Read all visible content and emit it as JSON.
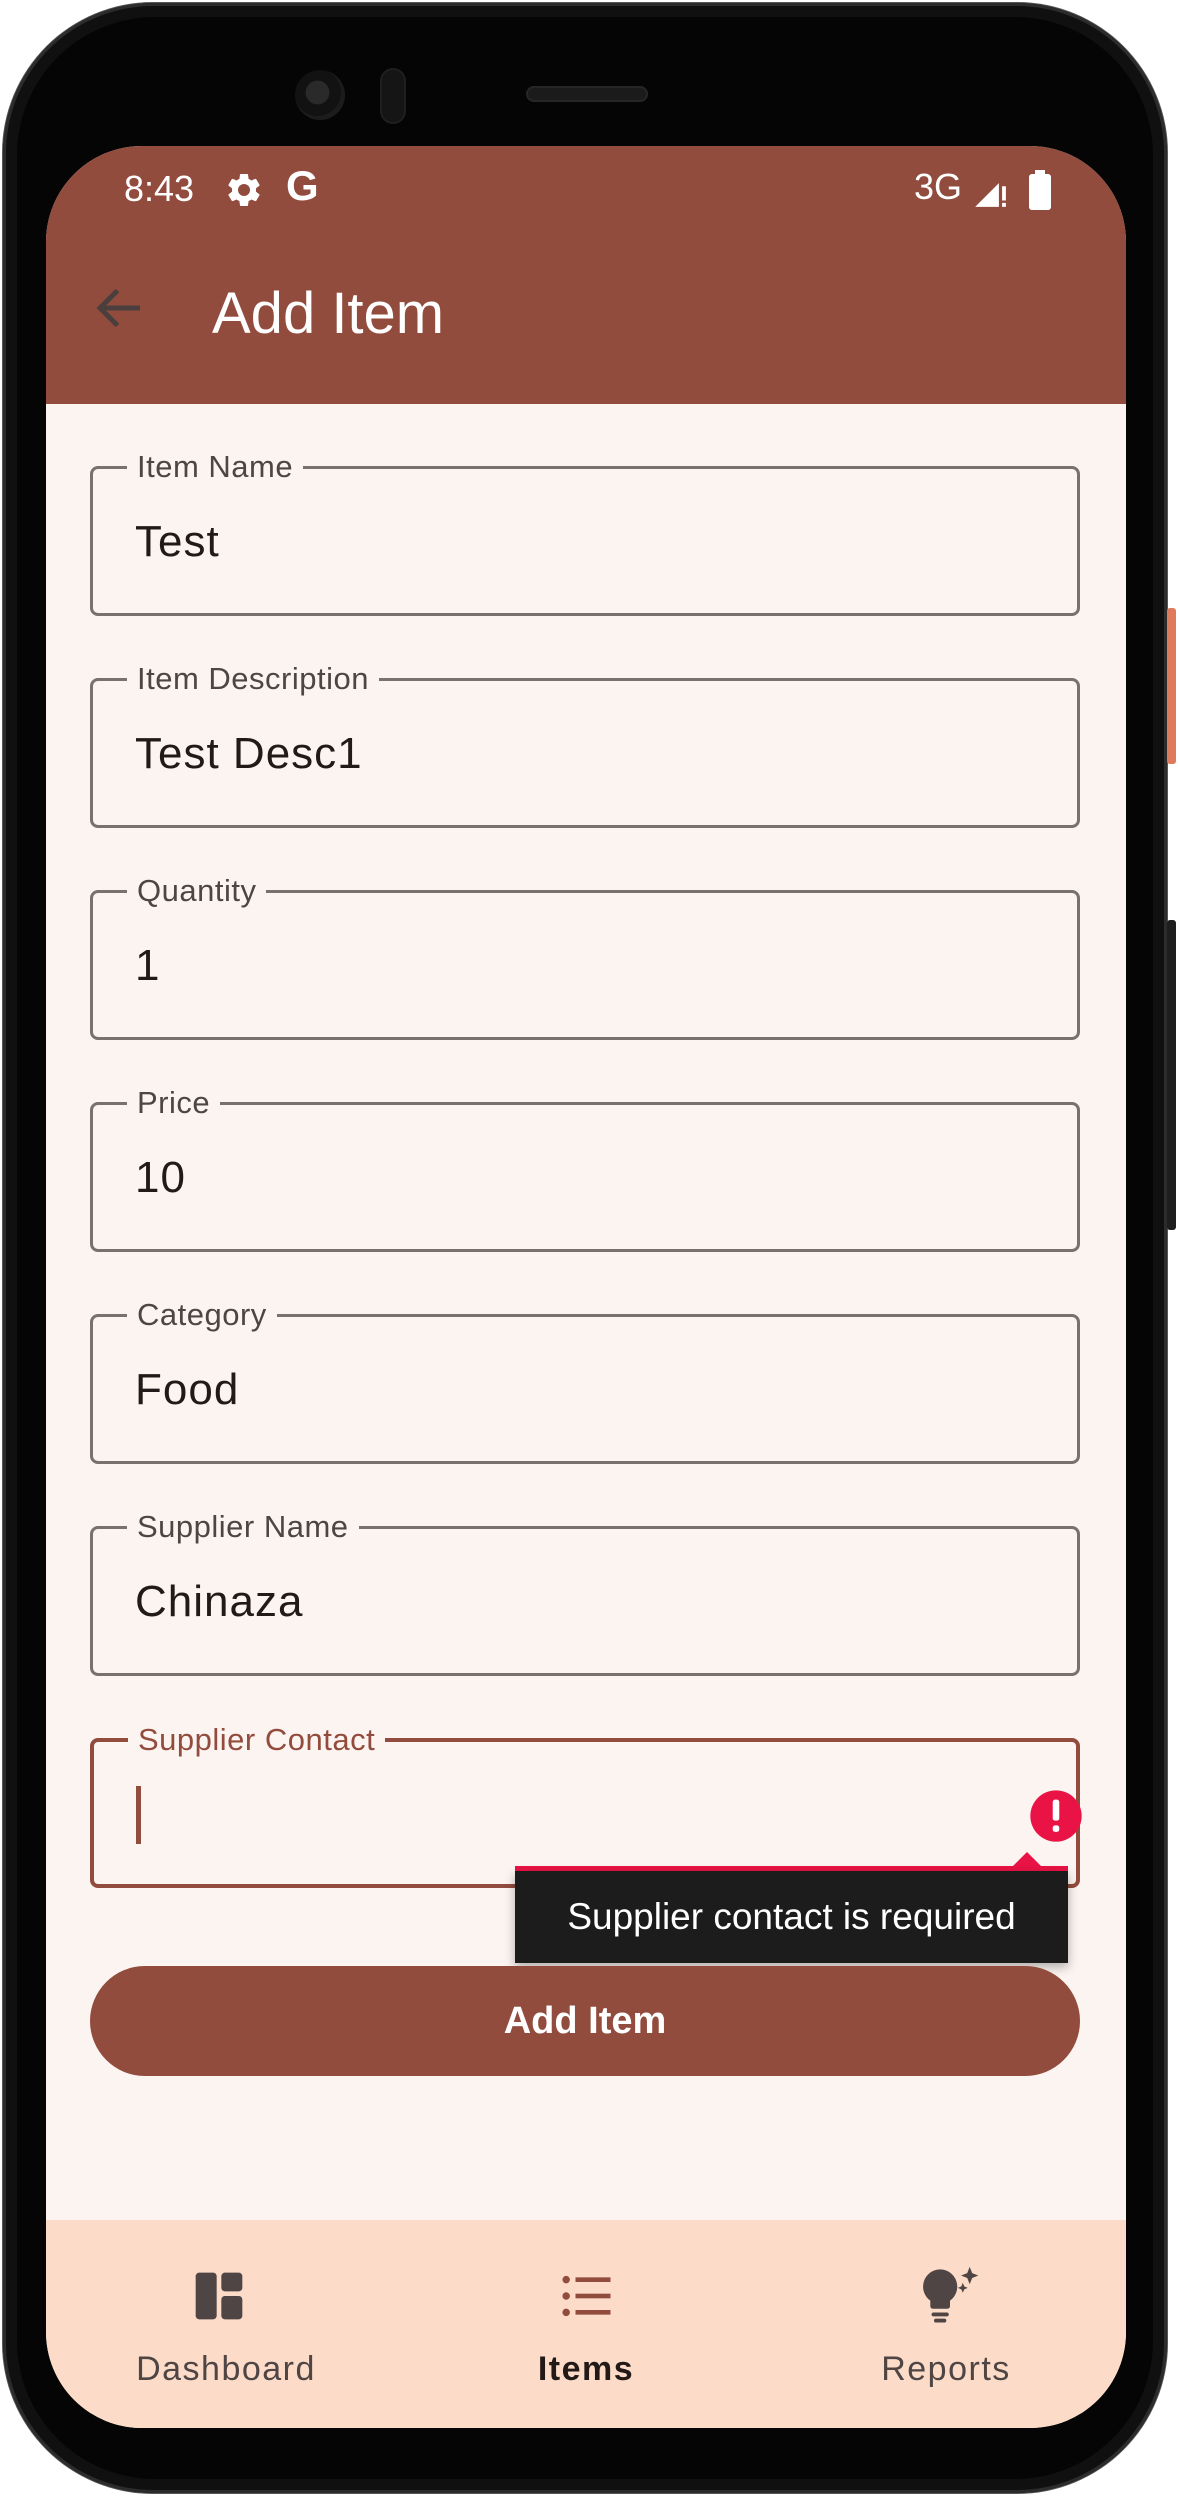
{
  "status_bar": {
    "time": "8:43",
    "g_glyph": "G",
    "network": "3G",
    "icons": [
      "gear-icon",
      "google-icon",
      "signal-icon",
      "battery-icon"
    ]
  },
  "app_bar": {
    "title": "Add Item",
    "back_icon": "arrow-back-icon"
  },
  "form": {
    "fields": [
      {
        "label": "Item Name",
        "value": "Test"
      },
      {
        "label": "Item Description",
        "value": "Test Desc1"
      },
      {
        "label": "Quantity",
        "value": "1"
      },
      {
        "label": "Price",
        "value": "10"
      },
      {
        "label": "Category",
        "value": "Food"
      },
      {
        "label": "Supplier Name",
        "value": "Chinaza"
      },
      {
        "label": "Supplier Contact",
        "value": ""
      }
    ],
    "error_icon": "error-icon",
    "error_message": "Supplier contact is required",
    "submit_label": "Add Item"
  },
  "bottom_nav": {
    "items": [
      {
        "label": "Dashboard",
        "icon": "dashboard-icon",
        "active": false
      },
      {
        "label": "Items",
        "icon": "list-icon",
        "active": true
      },
      {
        "label": "Reports",
        "icon": "lightbulb-icon",
        "active": false
      }
    ]
  },
  "colors": {
    "primary": "#924c3e",
    "background": "#fcf4f1",
    "nav_background": "#fcdcc8",
    "error": "#e91345",
    "tooltip_background": "#1c1c1c"
  }
}
